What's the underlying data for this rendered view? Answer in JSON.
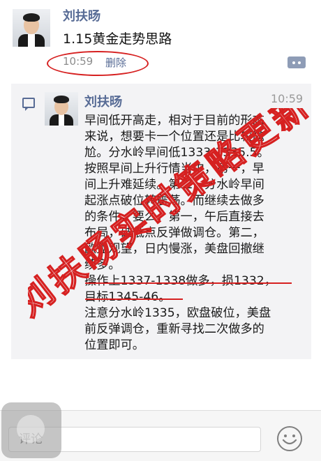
{
  "post": {
    "author": "刘扶旸",
    "title": "1.15黄金走势思路",
    "time": "10:59",
    "delete_label": "删除"
  },
  "quote": {
    "author": "刘扶旸",
    "time": "10:59",
    "lines": [
      "早间低开高走，相对于目前的形态",
      "来说，想要卡一个位置还是比较尴",
      "尬。分水岭早间低1333-1335.5。",
      "按照早间上升行情当中，第一，早",
      "间上升难延续。第二，分水岭早间",
      "起涨点破位转震荡。而继续去做多",
      "的条件，要么，第一，午后直接去",
      "布局，破低点反弹做调仓。第二，",
      "欧盘观望，日内慢涨，美盘回撤继",
      "续多。",
      "操作上1337-1338做多，损1332，",
      "目标1345-46。",
      "注意分水岭1335，欧盘破位，美盘",
      "前反弹调仓，重新寻找二次做多的",
      "位置即可。"
    ]
  },
  "watermark": {
    "text_chars": [
      "刘",
      "扶",
      "旸",
      "实",
      "时",
      "策",
      "略",
      "更",
      "新"
    ],
    "color": "#d62020"
  },
  "bottom_bar": {
    "comment_placeholder": "评论"
  },
  "colors": {
    "link": "#576b95",
    "annotation_red": "#d62020"
  }
}
